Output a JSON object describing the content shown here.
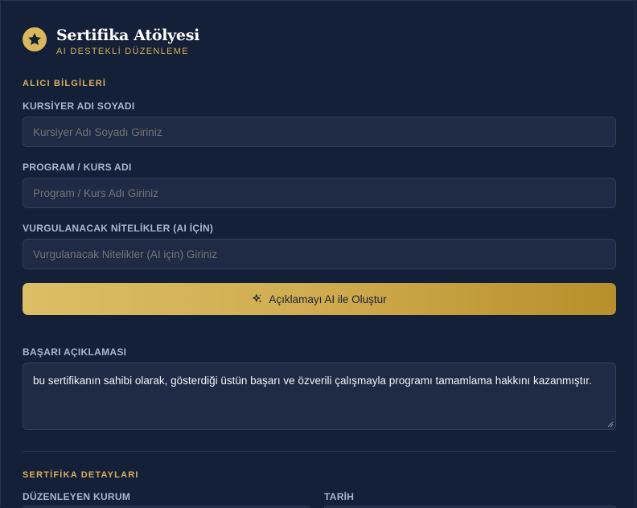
{
  "header": {
    "title": "Sertifika Atölyesi",
    "subtitle": "AI DESTEKLİ DÜZENLEME",
    "logo_icon": "star-icon"
  },
  "recipient": {
    "section_title": "ALICI BİLGİLERİ",
    "name": {
      "label": "KURSİYER ADI SOYADI",
      "placeholder": "Kursiyer Adı Soyadı Giriniz",
      "value": ""
    },
    "program": {
      "label": "PROGRAM / KURS ADI",
      "placeholder": "Program / Kurs Adı Giriniz",
      "value": ""
    },
    "qualities": {
      "label": "VURGULANACAK NİTELİKLER (AI İÇİN)",
      "placeholder": "Vurgulanacak Nitelikler (AI için) Giriniz",
      "value": ""
    },
    "ai_button": {
      "label": "Açıklamayı AI ile Oluştur",
      "icon": "sparkle-icon"
    }
  },
  "description": {
    "label": "BAŞARI AÇIKLAMASI",
    "value": "bu sertifikanın sahibi olarak, gösterdiği üstün başarı ve özverili çalışmayla programı tamamlama hakkını kazanmıştır."
  },
  "details": {
    "section_title": "SERTİFİKA DETAYLARI",
    "organizer_label": "DÜZENLEYEN KURUM",
    "date_label": "TARİH"
  },
  "colors": {
    "background": "#141f38",
    "accent_gold": "#d9b15a",
    "input_bg": "#1f2a44"
  }
}
